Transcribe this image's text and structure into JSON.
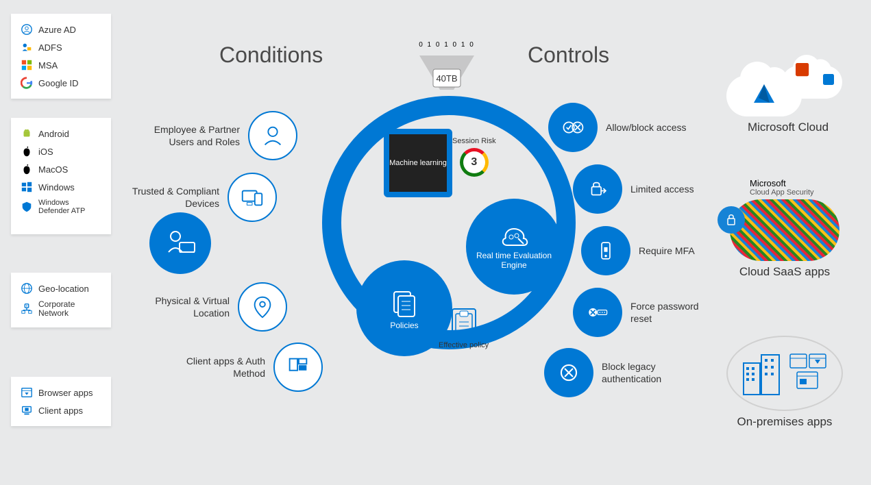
{
  "headings": {
    "conditions": "Conditions",
    "controls": "Controls"
  },
  "funnel": {
    "data_size": "40TB",
    "bits": "0 1 0 1 0 1 0"
  },
  "signal_panels": {
    "identity": [
      {
        "label": "Azure AD",
        "icon": "azure-ad-icon",
        "color": "#0078d4"
      },
      {
        "label": "ADFS",
        "icon": "adfs-icon",
        "color": "#0078d4"
      },
      {
        "label": "MSA",
        "icon": "msa-icon",
        "color": "#00a4ef"
      },
      {
        "label": "Google ID",
        "icon": "google-icon",
        "color": "#ea4335"
      }
    ],
    "devices": [
      {
        "label": "Android",
        "icon": "android-icon",
        "color": "#a4c639"
      },
      {
        "label": "iOS",
        "icon": "apple-icon",
        "color": "#000"
      },
      {
        "label": "MacOS",
        "icon": "apple-icon",
        "color": "#000"
      },
      {
        "label": "Windows",
        "icon": "windows-icon",
        "color": "#0078d4"
      },
      {
        "label": "Windows Defender ATP",
        "icon": "defender-icon",
        "color": "#0078d4"
      }
    ],
    "location": [
      {
        "label": "Geo-location",
        "icon": "globe-icon",
        "color": "#0078d4"
      },
      {
        "label": "Corporate Network",
        "icon": "network-icon",
        "color": "#0078d4"
      }
    ],
    "apps": [
      {
        "label": "Browser apps",
        "icon": "browser-icon",
        "color": "#0078d4"
      },
      {
        "label": "Client apps",
        "icon": "client-icon",
        "color": "#0078d4"
      }
    ]
  },
  "conditions": [
    {
      "label": "Employee & Partner Users and Roles",
      "icon": "user-icon"
    },
    {
      "label": "Trusted & Compliant Devices",
      "icon": "devices-icon"
    },
    {
      "label": "Physical & Virtual Location",
      "icon": "location-pin-icon"
    },
    {
      "label": "Client apps & Auth Method",
      "icon": "apps-grid-icon"
    }
  ],
  "controls": [
    {
      "label": "Allow/block access",
      "icon": "allow-block-icon"
    },
    {
      "label": "Limited access",
      "icon": "limited-access-icon"
    },
    {
      "label": "Require MFA",
      "icon": "mfa-phone-icon"
    },
    {
      "label": "Force password reset",
      "icon": "password-reset-icon"
    },
    {
      "label": "Block legacy authentication",
      "icon": "block-legacy-icon"
    }
  ],
  "center": {
    "machine_learning": "Machine learning",
    "session_risk_label": "Session Risk",
    "session_risk_value": "3",
    "policies": "Policies",
    "effective_policy": "Effective policy",
    "rte": "Real time Evaluation Engine"
  },
  "destinations": {
    "ms_cloud": {
      "title": "Microsoft Cloud"
    },
    "saas": {
      "title": "Cloud SaaS apps",
      "sub_title": "Microsoft",
      "sub_text": "Cloud App Security"
    },
    "onprem": {
      "title": "On-premises apps"
    }
  },
  "colors": {
    "primary": "#0078d4",
    "dark": "#333",
    "bg": "#e8e9ea"
  }
}
